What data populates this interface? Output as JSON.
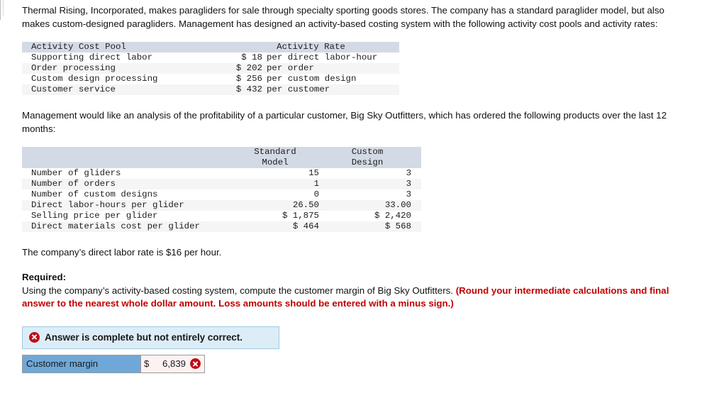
{
  "intro": {
    "paragraph1": "Thermal Rising, Incorporated, makes paragliders for sale through specialty sporting goods stores. The company has a standard paraglider model, but also makes custom-designed paragliders. Management has designed an activity-based costing system with the following activity cost pools and activity rates:",
    "paragraph2": "Management would like an analysis of the profitability of a particular customer, Big Sky Outfitters, which has ordered the following products over the last 12 months:",
    "paragraph3": "The company’s direct labor rate is $16 per hour."
  },
  "rates_table": {
    "headers": [
      "Activity Cost Pool",
      "Activity Rate"
    ],
    "rows": [
      {
        "pool": "Supporting direct labor",
        "amount": "$ 18",
        "unit": "per direct labor-hour"
      },
      {
        "pool": "Order processing",
        "amount": "$ 202",
        "unit": "per order"
      },
      {
        "pool": "Custom design processing",
        "amount": "$ 256",
        "unit": "per custom design"
      },
      {
        "pool": "Customer service",
        "amount": "$ 432",
        "unit": "per customer"
      }
    ]
  },
  "customer_table": {
    "headers": {
      "blank": "",
      "col1_line1": "Standard",
      "col1_line2": "Model",
      "col2_line1": "Custom",
      "col2_line2": "Design"
    },
    "rows": [
      {
        "label": "Number of gliders",
        "standard": "15",
        "custom": "3"
      },
      {
        "label": "Number of orders",
        "standard": "1",
        "custom": "3"
      },
      {
        "label": "Number of custom designs",
        "standard": "0",
        "custom": "3"
      },
      {
        "label": "Direct labor-hours per glider",
        "standard": "26.50",
        "custom": "33.00"
      },
      {
        "label": "Selling price per glider",
        "standard": "$ 1,875",
        "custom": "$ 2,420"
      },
      {
        "label": "Direct materials cost per glider",
        "standard": "$ 464",
        "custom": "$ 568"
      }
    ]
  },
  "required": {
    "label": "Required:",
    "text_plain": "Using the company’s activity-based costing system, compute the customer margin of Big Sky Outfitters.",
    "text_emphasis": "(Round your intermediate calculations and final answer to the nearest whole dollar amount. Loss amounts should be entered with a minus sign.)",
    "emphasis_color": "#c00000"
  },
  "answer": {
    "alert_text": "Answer is complete but not entirely correct.",
    "alert_icon": "error-x-icon",
    "alert_bg": "#dcedf7",
    "alert_border": "#9ecae6",
    "row_label": "Customer margin",
    "row_label_bg": "#6fa8d8",
    "currency_symbol": "$",
    "value": "6,839",
    "value_status_icon": "error-x-icon",
    "value_bg": "#fdf2f2"
  }
}
